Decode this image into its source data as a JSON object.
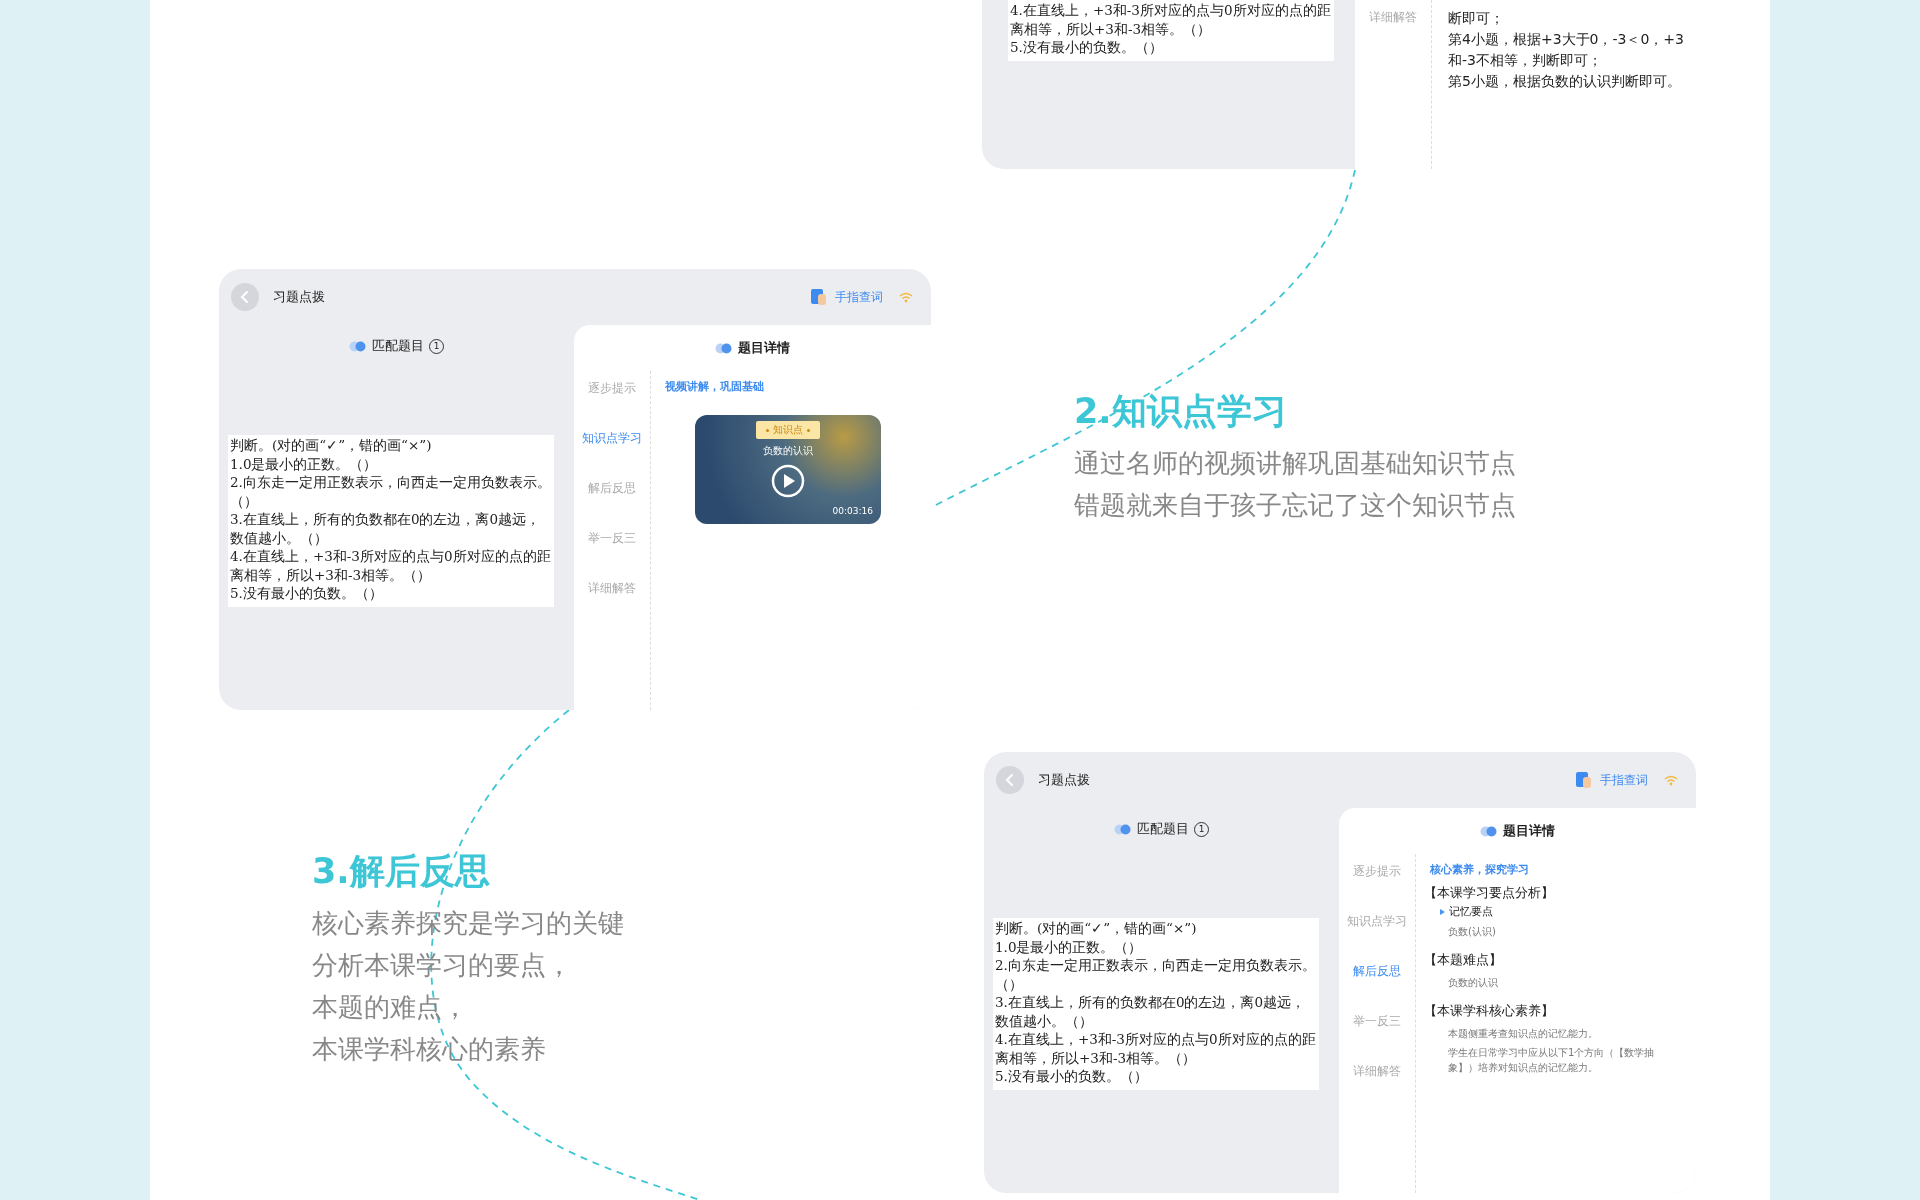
{
  "top_panel": {
    "question_lines": [
      "4.在直线上，+3和-3所对应的点与0所对应的点的距离相等，所以+3和-3相等。（）",
      "5.没有最小的负数。（）"
    ],
    "nav_items": [
      {
        "label": "详细解答",
        "selected": false
      }
    ],
    "answer_lines": [
      "断即可；",
      "第4小题，根据+3大于0，-3＜0，+3",
      "和-3不相等，判断即可；",
      "第5小题，根据负数的认识判断即可。"
    ]
  },
  "sections": [
    {
      "title": "2.知识点学习",
      "lines": [
        "通过名师的视频讲解巩固基础知识节点",
        "错题就来自于孩子忘记了这个知识节点"
      ]
    },
    {
      "title": "3.解后反思",
      "lines": [
        "核心素养探究是学习的关键",
        "分析本课学习的要点，",
        "本题的难点，",
        "本课学科核心的素养"
      ]
    }
  ],
  "panels": [
    {
      "header_title": "习题点拨",
      "lookup_label": "手指查词",
      "match_title": "匹配题目",
      "match_count": "1",
      "question_lines": [
        "判断。(对的画“✓”，错的画“×”)",
        "1.0是最小的正数。（）",
        "2.向东走一定用正数表示，向西走一定用负数表示。（）",
        "3.在直线上，所有的负数都在0的左边，离0越远，数值越小。（）",
        "4.在直线上，+3和-3所对应的点与0所对应的点的距离相等，所以+3和-3相等。（）",
        "5.没有最小的负数。（）"
      ],
      "detail_title": "题目详情",
      "nav_items": [
        {
          "label": "逐步提示",
          "selected": false
        },
        {
          "label": "知识点学习",
          "selected": true
        },
        {
          "label": "解后反思",
          "selected": false
        },
        {
          "label": "举一反三",
          "selected": false
        },
        {
          "label": "详细解答",
          "selected": false
        }
      ],
      "content": {
        "kind": "video",
        "heading": "视频讲解，巩固基础",
        "tag": "知识点",
        "video_title": "负数的认识",
        "duration": "00:03:16"
      }
    },
    {
      "header_title": "习题点拨",
      "lookup_label": "手指查词",
      "match_title": "匹配题目",
      "match_count": "1",
      "question_lines": [
        "判断。(对的画“✓”，错的画“×”)",
        "1.0是最小的正数。（）",
        "2.向东走一定用正数表示，向西走一定用负数表示。（）",
        "3.在直线上，所有的负数都在0的左边，离0越远，数值越小。（）",
        "4.在直线上，+3和-3所对应的点与0所对应的点的距离相等，所以+3和-3相等。（）",
        "5.没有最小的负数。（）"
      ],
      "detail_title": "题目详情",
      "nav_items": [
        {
          "label": "逐步提示",
          "selected": false
        },
        {
          "label": "知识点学习",
          "selected": false
        },
        {
          "label": "解后反思",
          "selected": true
        },
        {
          "label": "举一反三",
          "selected": false
        },
        {
          "label": "详细解答",
          "selected": false
        }
      ],
      "content": {
        "kind": "analysis",
        "heading": "核心素养，探究学习",
        "blocks": [
          {
            "title": "【本课学习要点分析】",
            "items": [
              {
                "kind": "bullet",
                "text": "记忆要点"
              },
              {
                "kind": "note",
                "text": "负数(认识)"
              }
            ]
          },
          {
            "title": "【本题难点】",
            "items": [
              {
                "kind": "note",
                "text": "负数的认识"
              }
            ]
          },
          {
            "title": "【本课学科核心素养】",
            "items": [
              {
                "kind": "note",
                "text": "本题侧重考查知识点的记忆能力。"
              },
              {
                "kind": "note",
                "text": "学生在日常学习中应从以下1个方向（【数学抽象】）培养对知识点的记忆能力。"
              }
            ]
          }
        ]
      }
    }
  ]
}
